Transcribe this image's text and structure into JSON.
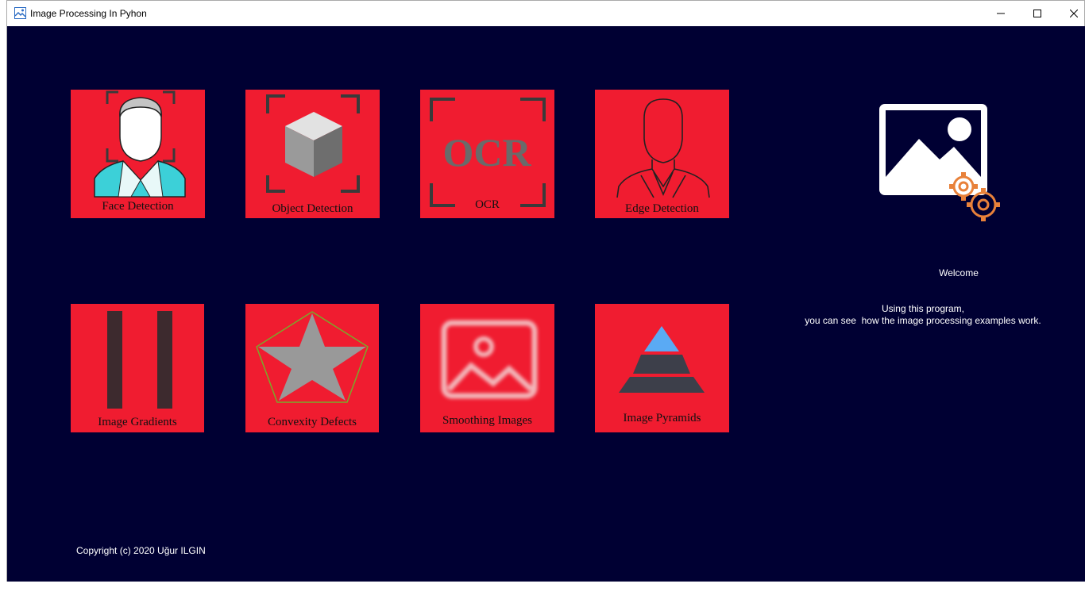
{
  "window": {
    "title": "Image Processing In Pyhon",
    "icon": "image-processing-app-icon",
    "controls": {
      "minimize": "minimize-icon",
      "maximize": "maximize-icon",
      "close": "close-icon"
    }
  },
  "colors": {
    "background": "#000033",
    "tile": "#f01c30",
    "text": "#ffffff",
    "tile_text": "#111111",
    "accent_orange": "#e8813a",
    "accent_blue": "#5aaaf4"
  },
  "tiles": [
    {
      "label": "Face Detection",
      "icon": "face-detection-icon"
    },
    {
      "label": "Object Detection",
      "icon": "cube-icon"
    },
    {
      "label": "OCR",
      "icon": "ocr-icon",
      "art_text": "OCR"
    },
    {
      "label": "Edge Detection",
      "icon": "edge-outline-icon"
    },
    {
      "label": "Image Gradients",
      "icon": "gradient-bars-icon"
    },
    {
      "label": "Convexity Defects",
      "icon": "star-hull-icon"
    },
    {
      "label": "Smoothing Images",
      "icon": "blurred-image-icon"
    },
    {
      "label": "Image Pyramids",
      "icon": "pyramid-icon"
    }
  ],
  "welcome": {
    "icon": "image-gears-icon",
    "title": "Welcome",
    "line1": "Using this program,",
    "line2": "you can see  how the image processing examples work."
  },
  "footer": {
    "copyright": "Copyright (c) 2020 Uğur ILGIN"
  }
}
